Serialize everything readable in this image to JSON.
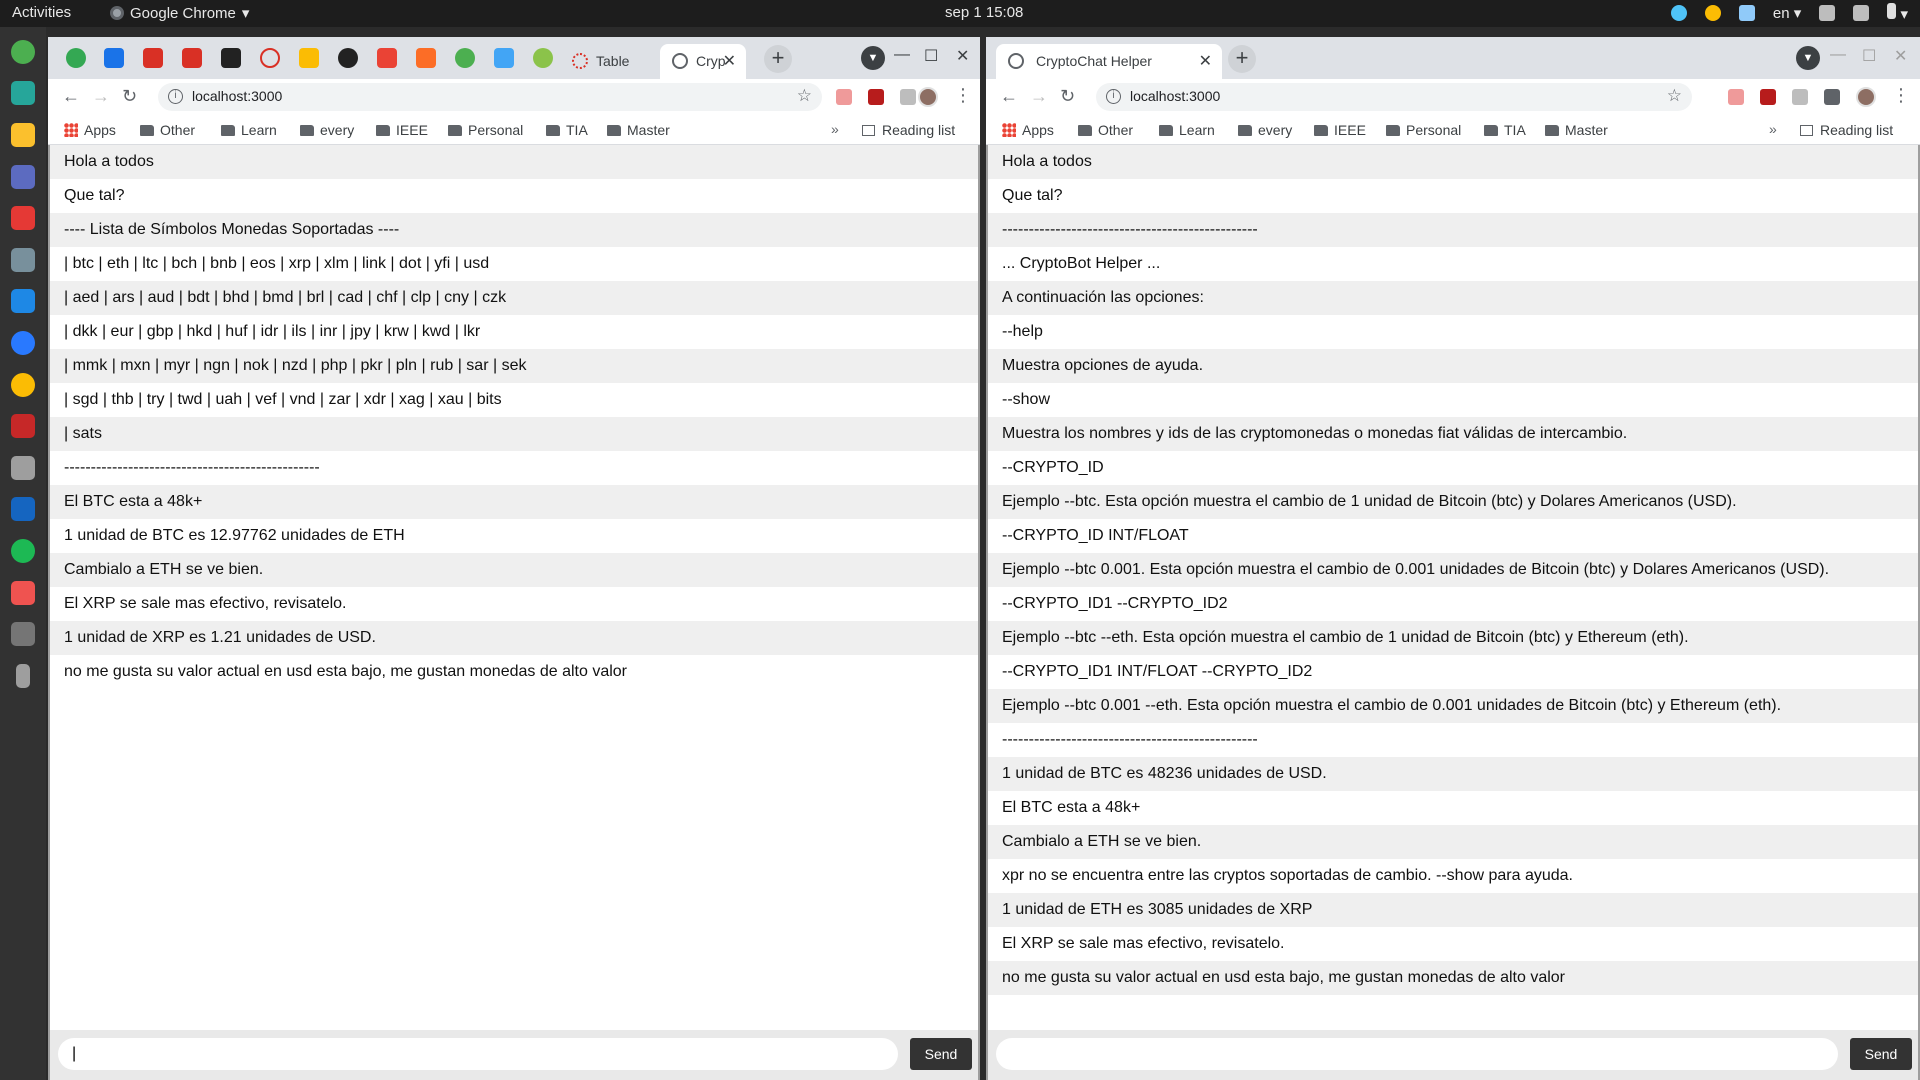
{
  "topbar": {
    "activities": "Activities",
    "app_name": "Google Chrome",
    "app_caret": "▾",
    "clock": "sep 1  15:08",
    "language": "en",
    "lang_caret": "▾",
    "power_caret": "▾"
  },
  "dock": {
    "apps_grid": "⋮⋮⋮",
    "icons": [
      "chrome-launcher-icon",
      "calendar-icon",
      "notes-icon",
      "screenshot-icon",
      "slides-icon",
      "photo-icon",
      "vscode-icon",
      "writer-icon",
      "chrome-icon",
      "filezilla-icon",
      "files-icon",
      "vscode-alt-icon",
      "spotify-icon",
      "anydesk-icon",
      "drive-icon",
      "usb-icon"
    ]
  },
  "left_window": {
    "tab_inactive_label": "Table",
    "tab_active_label": "Cryp",
    "tab_close": "✕",
    "new_tab": "+",
    "minimize": "—",
    "maximize": "☐",
    "close": "✕",
    "url": "localhost:3000",
    "bookmarks": [
      "Apps",
      "Other",
      "Learn",
      "every",
      "IEEE",
      "Personal",
      "TIA",
      "Master"
    ],
    "more": "»",
    "reading_list": "Reading list",
    "messages": [
      "Hola a todos",
      "Que tal?",
      "---- Lista de Símbolos Monedas Soportadas ----",
      "| btc | eth | ltc | bch | bnb | eos | xrp | xlm | link | dot | yfi | usd",
      "| aed | ars | aud | bdt | bhd | bmd | brl | cad | chf | clp | cny | czk",
      "| dkk | eur | gbp | hkd | huf | idr | ils | inr | jpy | krw | kwd | lkr",
      "| mmk | mxn | myr | ngn | nok | nzd | php | pkr | pln | rub | sar | sek",
      "| sgd | thb | try | twd | uah | vef | vnd | zar | xdr | xag | xau | bits",
      "| sats",
      "------------------------------------------------",
      "El BTC esta a 48k+",
      "1 unidad de BTC es 12.97762 unidades de ETH",
      "Cambialo a ETH se ve bien.",
      "El XRP se sale mas efectivo, revisatelo.",
      "1 unidad de XRP es 1.21 unidades de USD.",
      "no me gusta su valor actual en usd esta bajo, me gustan monedas de alto valor"
    ],
    "input_value": "|",
    "send_label": "Send"
  },
  "right_window": {
    "tab_active_label": "CryptoChat Helper",
    "tab_close": "✕",
    "new_tab": "+",
    "minimize": "—",
    "maximize": "☐",
    "close": "✕",
    "url": "localhost:3000",
    "bookmarks": [
      "Apps",
      "Other",
      "Learn",
      "every",
      "IEEE",
      "Personal",
      "TIA",
      "Master"
    ],
    "more": "»",
    "reading_list": "Reading list",
    "messages": [
      "Hola a todos",
      "Que tal?",
      "------------------------------------------------",
      "... CryptoBot Helper ...",
      "A continuación las opciones:",
      "--help",
      "Muestra opciones de ayuda.",
      "--show",
      "Muestra los nombres y ids de las cryptomonedas o monedas fiat válidas de intercambio.",
      "--CRYPTO_ID",
      "Ejemplo --btc. Esta opción muestra el cambio de 1 unidad de Bitcoin (btc) y Dolares Americanos (USD).",
      "--CRYPTO_ID INT/FLOAT",
      "Ejemplo --btc 0.001. Esta opción muestra el cambio de 0.001 unidades de Bitcoin (btc) y Dolares Americanos (USD).",
      "--CRYPTO_ID1 --CRYPTO_ID2",
      "Ejemplo --btc --eth. Esta opción muestra el cambio de 1 unidad de Bitcoin (btc) y Ethereum (eth).",
      "--CRYPTO_ID1 INT/FLOAT --CRYPTO_ID2",
      "Ejemplo --btc 0.001 --eth. Esta opción muestra el cambio de 0.001 unidades de Bitcoin (btc) y Ethereum (eth).",
      "------------------------------------------------",
      "1 unidad de BTC es 48236 unidades de USD.",
      "El BTC esta a 48k+",
      "Cambialo a ETH se ve bien.",
      "xpr no se encuentra entre las cryptos soportadas de cambio. --show para ayuda.",
      "1 unidad de ETH es 3085 unidades de XRP",
      "El XRP se sale mas efectivo, revisatelo.",
      "no me gusta su valor actual en usd esta bajo, me gustan monedas de alto valor"
    ],
    "input_value": "",
    "send_label": "Send"
  }
}
